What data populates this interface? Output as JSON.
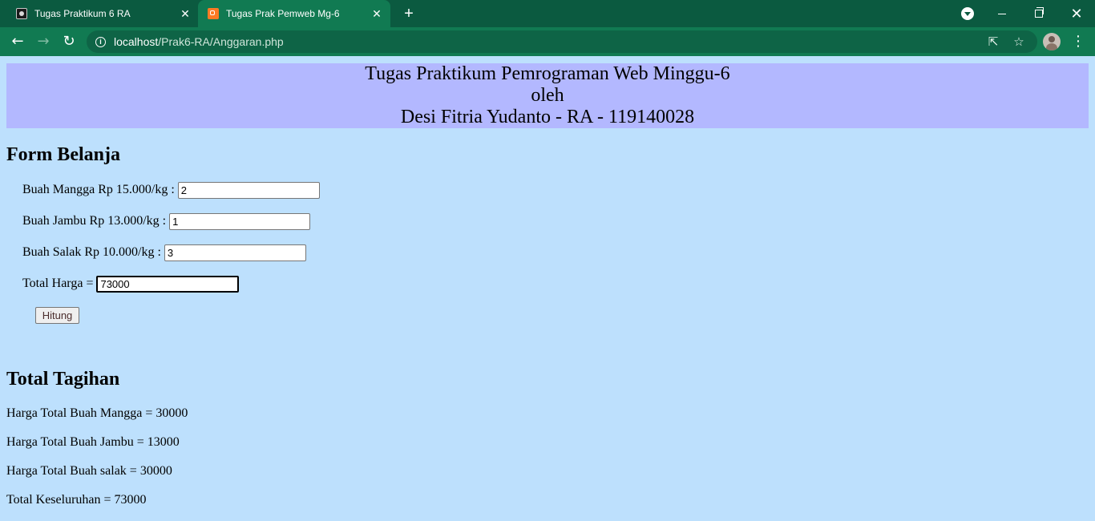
{
  "browser": {
    "tabs": [
      {
        "title": "Tugas Praktikum 6 RA",
        "active": false
      },
      {
        "title": "Tugas Prak Pemweb Mg-6",
        "active": true
      }
    ],
    "new_tab_label": "+",
    "address": {
      "host": "localhost",
      "path": "/Prak6-RA/Anggaran.php"
    }
  },
  "header": {
    "line1": "Tugas Praktikum Pemrograman Web Minggu-6",
    "line2": "oleh",
    "line3": "Desi Fitria Yudanto - RA - 119140028"
  },
  "form": {
    "heading": "Form Belanja",
    "fields": [
      {
        "label": "Buah Mangga Rp 15.000/kg :",
        "value": "2"
      },
      {
        "label": "Buah Jambu Rp 13.000/kg :",
        "value": "1"
      },
      {
        "label": "Buah Salak Rp 10.000/kg :",
        "value": "3"
      },
      {
        "label": "Total Harga =",
        "value": "73000"
      }
    ],
    "button_label": "Hitung"
  },
  "summary": {
    "heading": "Total Tagihan",
    "lines": [
      "Harga Total Buah Mangga = 30000",
      "Harga Total Buah Jambu = 13000",
      "Harga Total Buah salak = 30000",
      "Total Keseluruhan = 73000"
    ]
  },
  "colors": {
    "page_bg": "#bde0fd",
    "header_bg": "#b3b8ff",
    "tabbar_bg": "#0b5a40",
    "toolbar_bg": "#117a52"
  }
}
